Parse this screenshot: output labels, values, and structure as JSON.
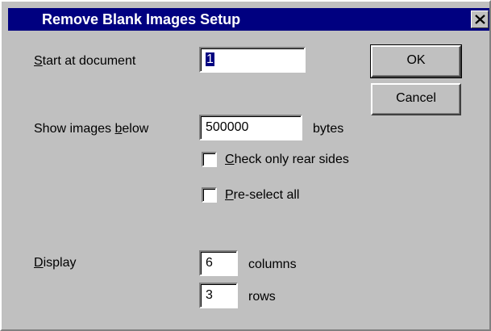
{
  "window": {
    "title": "Remove Blank Images Setup",
    "close_icon": "close-icon"
  },
  "start_at_document": {
    "label_underlined": "S",
    "label_rest": "tart at document",
    "value": "1"
  },
  "show_images_below": {
    "label_before": "Show images ",
    "label_underlined": "b",
    "label_after": "elow",
    "value": "500000",
    "unit": "bytes"
  },
  "check_only_rear_sides": {
    "label_underlined": "C",
    "label_rest": "heck only rear sides",
    "checked": false
  },
  "pre_select_all": {
    "label_underlined": "P",
    "label_rest": "re-select all",
    "checked": false
  },
  "display": {
    "label_underlined": "D",
    "label_rest": "isplay",
    "columns_value": "6",
    "columns_unit": "columns",
    "rows_value": "3",
    "rows_unit": "rows"
  },
  "buttons": {
    "ok_label": "OK",
    "cancel_label": "Cancel"
  },
  "colors": {
    "title_bar": "#000080",
    "dialog_face": "#c0c0c0",
    "field_background": "#ffffff"
  }
}
